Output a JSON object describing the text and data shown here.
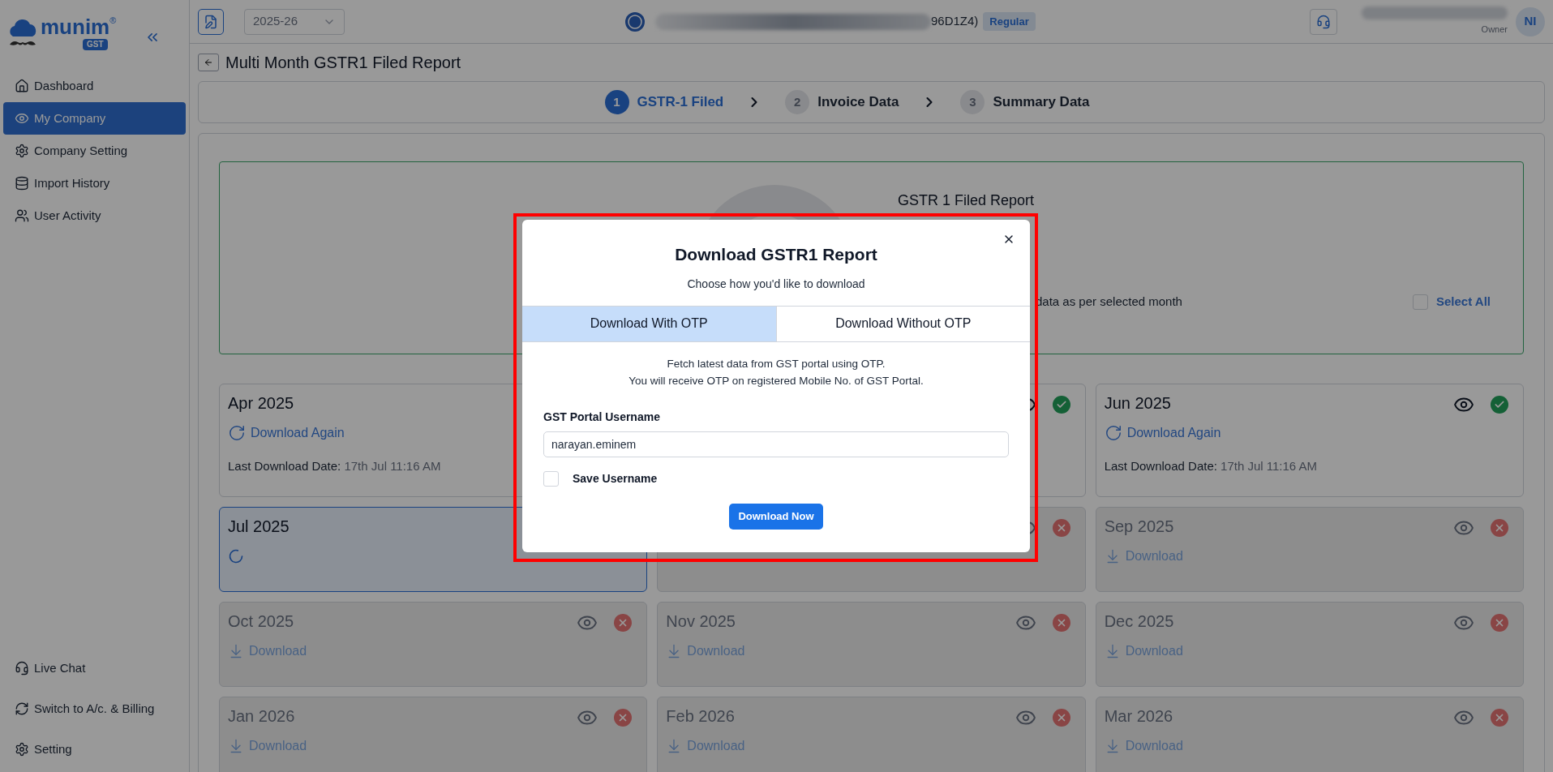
{
  "sidebar": {
    "logo": {
      "name": "munim",
      "mark": "®",
      "badge": "GST"
    },
    "items": [
      {
        "label": "Dashboard",
        "selected": false
      },
      {
        "label": "My Company",
        "selected": true
      },
      {
        "label": "Company Setting",
        "selected": false
      },
      {
        "label": "Import History",
        "selected": false
      },
      {
        "label": "User Activity",
        "selected": false
      }
    ],
    "bottom_items": [
      {
        "label": "Live Chat"
      },
      {
        "label": "Switch to A/c. & Billing"
      },
      {
        "label": "Setting"
      }
    ]
  },
  "top_bar": {
    "year": "2025-26",
    "company_suffix": "96D1Z4)",
    "company_type": "Regular",
    "user_role": "Owner",
    "avatar": "NI"
  },
  "page": {
    "title": "Multi Month GSTR1 Filed Report",
    "steps": [
      {
        "number": "1",
        "label": "GSTR-1 Filed",
        "selected": true
      },
      {
        "number": "2",
        "label": "Invoice Data",
        "selected": false
      },
      {
        "number": "3",
        "label": "Summary Data",
        "selected": false
      }
    ]
  },
  "summary": {
    "title": "GSTR 1 Filed Report",
    "note": "data as per selected month",
    "select_all": {
      "label": "Select All",
      "checked": false
    }
  },
  "months": [
    {
      "kind": "downloaded",
      "title": "Apr 2025",
      "action": "Download Again",
      "last_label": "Last Download Date:",
      "last_value": "17th Jul 11:16 AM",
      "selected": false
    },
    {
      "kind": "downloaded",
      "filed": true,
      "selected": false
    },
    {
      "kind": "downloaded",
      "title": "Jun 2025",
      "filed": true,
      "action": "Download Again",
      "last_label": "Last Download Date:",
      "last_value": "17th Jul 11:16 AM",
      "selected": false
    },
    {
      "kind": "loading",
      "title": "Jul 2025",
      "selected": true
    },
    {
      "kind": "pending",
      "filed": false,
      "selected": false
    },
    {
      "kind": "pending",
      "title": "Sep 2025",
      "filed": false,
      "action": "Download",
      "selected": false
    },
    {
      "kind": "pending",
      "title": "Oct 2025",
      "filed": false,
      "action": "Download",
      "selected": false
    },
    {
      "kind": "pending",
      "title": "Nov 2025",
      "filed": false,
      "action": "Download",
      "selected": false
    },
    {
      "kind": "pending",
      "title": "Dec 2025",
      "filed": false,
      "action": "Download",
      "selected": false
    },
    {
      "kind": "pending",
      "title": "Jan 2026",
      "filed": false,
      "action": "Download",
      "selected": false
    },
    {
      "kind": "pending",
      "title": "Feb 2026",
      "filed": false,
      "action": "Download",
      "selected": false
    },
    {
      "kind": "pending",
      "title": "Mar 2026",
      "filed": false,
      "action": "Download",
      "selected": false
    }
  ],
  "modal": {
    "title": "Download GSTR1 Report",
    "subtitle": "Choose how you'd like to download",
    "tabs": [
      {
        "label": "Download With OTP",
        "selected": true
      },
      {
        "label": "Download Without OTP",
        "selected": false
      }
    ],
    "info": [
      "Fetch latest data from GST portal using OTP.",
      "You will receive OTP on registered Mobile No. of GST Portal."
    ],
    "field": {
      "label": "GST Portal Username",
      "value": "narayan.eminem"
    },
    "save": {
      "label": "Save Username",
      "checked": false
    },
    "button": "Download Now"
  }
}
